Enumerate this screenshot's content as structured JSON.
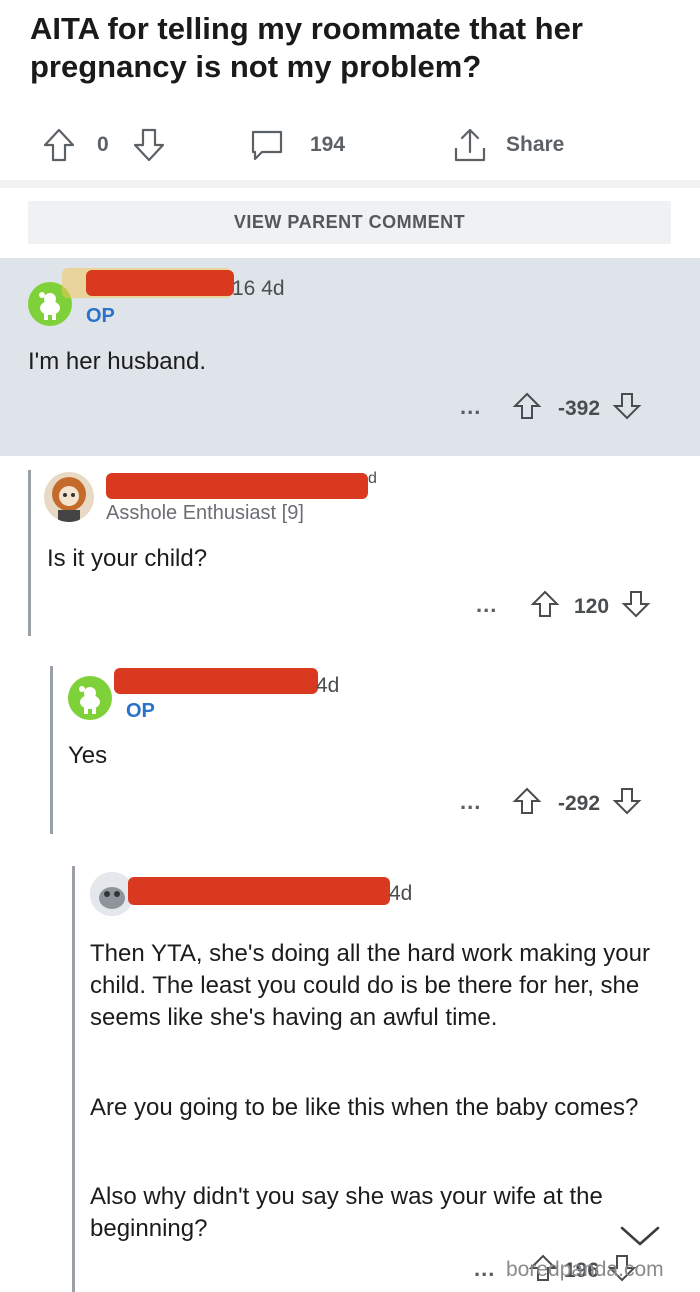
{
  "post": {
    "title": "AITA for telling my roommate that her pregnancy is not my problem?"
  },
  "actions": {
    "vote_count": "0",
    "comments_count": "194",
    "share_label": "Share"
  },
  "view_parent_label": "VIEW PARENT COMMENT",
  "comments": [
    {
      "time": "16 4d",
      "badge": "OP",
      "text": "I'm her husband.",
      "more": "...",
      "score": "-392"
    },
    {
      "time": "d",
      "flair": "Asshole Enthusiast [9]",
      "text": "Is it your child?",
      "more": "...",
      "score": "120"
    },
    {
      "time": "4d",
      "badge": "OP",
      "text": "Yes",
      "more": "...",
      "score": "-292"
    },
    {
      "time": "4d",
      "paragraphs": [
        "Then YTA, she's doing all the hard work making your child. The least you could do is be there for her, she seems like she's having an awful time.",
        "Are you going to be like this when the baby comes?",
        "Also why didn't you say she was your wife at the beginning?"
      ],
      "more": "...",
      "score": "196"
    }
  ],
  "watermark": "boredpanda.com",
  "icons": {
    "upvote": "arrow-up-icon",
    "downvote": "arrow-down-icon",
    "comment": "comment-bubble-icon",
    "share": "share-icon",
    "collapse": "chevron-down-icon",
    "snoo": "snoo-avatar-icon"
  },
  "colors": {
    "op_badge": "#2a73c8",
    "highlight_bg": "#dfe4ea",
    "redaction": "#d9391f",
    "snoo_bg": "#7fd13a"
  }
}
